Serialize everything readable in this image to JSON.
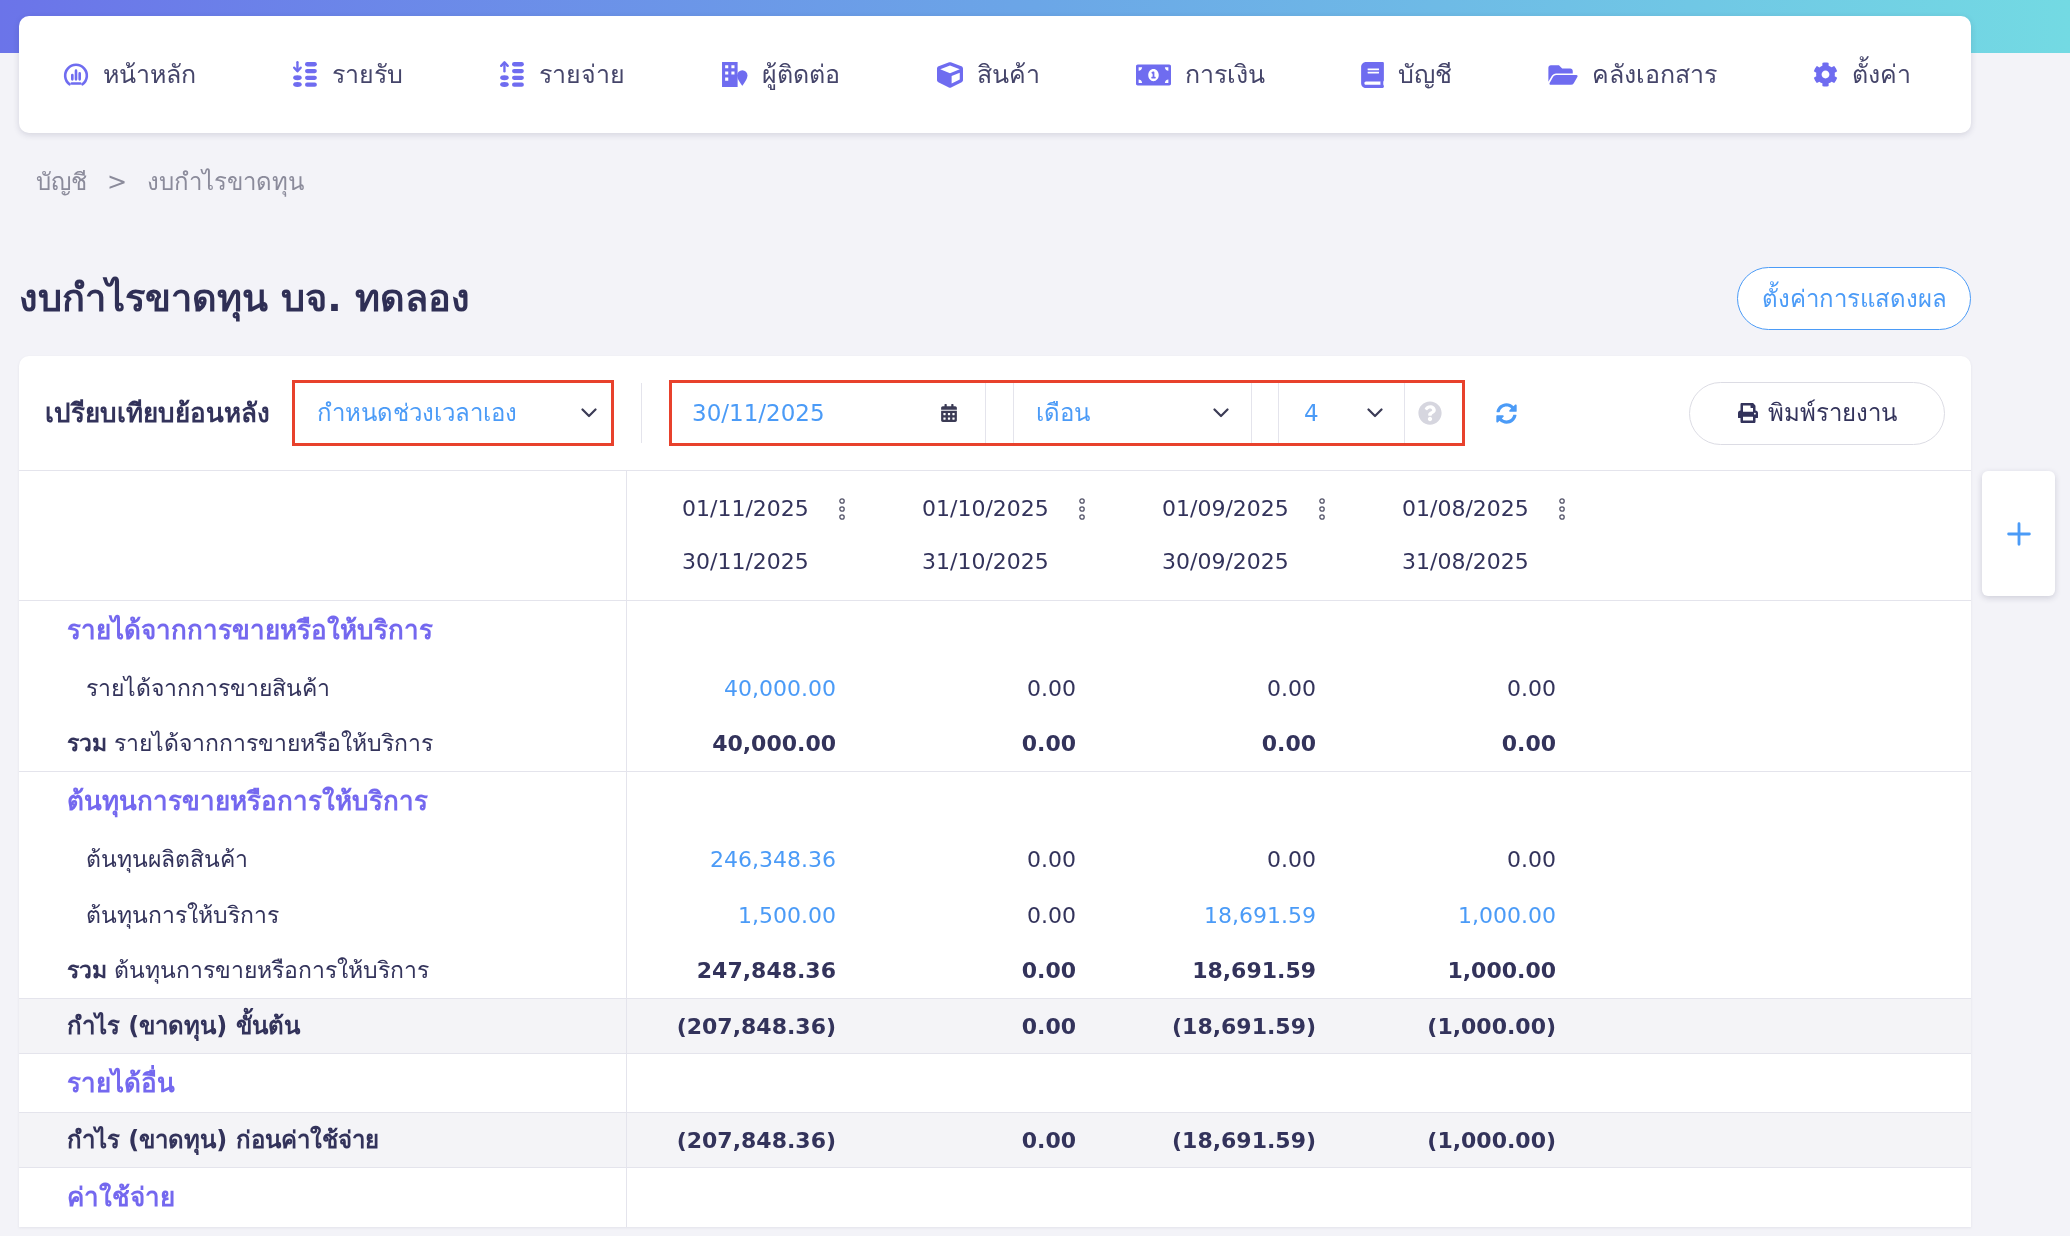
{
  "nav": {
    "items": [
      "หน้าหลัก",
      "รายรับ",
      "รายจ่าย",
      "ผู้ติดต่อ",
      "สินค้า",
      "การเงิน",
      "บัญชี",
      "คลังเอกสาร",
      "ตั้งค่า"
    ]
  },
  "breadcrumb": {
    "items": [
      "บัญชี",
      "งบกำไรขาดทุน"
    ],
    "separator": ">"
  },
  "title": "งบกำไรขาดทุน บจ. ทดลอง",
  "display_settings_button": {
    "label": "ตั้งค่าการแสดงผล"
  },
  "toolbar": {
    "label": "เปรียบเทียบย้อนหลัง",
    "range_select": {
      "value": "กำหนดช่วงเวลาเอง"
    },
    "date_field": {
      "value": "30/11/2025"
    },
    "period_select": {
      "value": "เดือน"
    },
    "count_select": {
      "value": "4"
    },
    "print_button": {
      "label": "พิมพ์รายงาน"
    }
  },
  "table": {
    "columns": [
      {
        "start": "01/11/2025",
        "end": "30/11/2025"
      },
      {
        "start": "01/10/2025",
        "end": "31/10/2025"
      },
      {
        "start": "01/09/2025",
        "end": "30/09/2025"
      },
      {
        "start": "01/08/2025",
        "end": "31/08/2025"
      }
    ],
    "rows": [
      {
        "kind": "section",
        "label": "รายได้จากการขายหรือให้บริการ"
      },
      {
        "kind": "item",
        "label": "รายได้จากการขายสินค้า",
        "values": [
          {
            "text": "40,000.00",
            "link": true
          },
          {
            "text": "0.00",
            "link": false
          },
          {
            "text": "0.00",
            "link": false
          },
          {
            "text": "0.00",
            "link": false
          }
        ]
      },
      {
        "kind": "total",
        "label": "**รวม** รายได้จากการขายหรือให้บริการ",
        "values": [
          "40,000.00",
          "0.00",
          "0.00",
          "0.00"
        ]
      },
      {
        "kind": "section",
        "label": "ต้นทุนการขายหรือการให้บริการ"
      },
      {
        "kind": "item",
        "label": "ต้นทุนผลิตสินค้า",
        "values": [
          {
            "text": "246,348.36",
            "link": true
          },
          {
            "text": "0.00",
            "link": false
          },
          {
            "text": "0.00",
            "link": false
          },
          {
            "text": "0.00",
            "link": false
          }
        ]
      },
      {
        "kind": "item",
        "label": "ต้นทุนการให้บริการ",
        "values": [
          {
            "text": "1,500.00",
            "link": true
          },
          {
            "text": "0.00",
            "link": false
          },
          {
            "text": "18,691.59",
            "link": true
          },
          {
            "text": "1,000.00",
            "link": true
          }
        ]
      },
      {
        "kind": "total",
        "label": "**รวม** ต้นทุนการขายหรือการให้บริการ",
        "values": [
          "247,848.36",
          "0.00",
          "18,691.59",
          "1,000.00"
        ]
      },
      {
        "kind": "subtotal",
        "label": "กำไร (ขาดทุน) ขั้นต้น",
        "values": [
          "(207,848.36)",
          "0.00",
          "(18,691.59)",
          "(1,000.00)"
        ]
      },
      {
        "kind": "section",
        "label": "รายได้อื่น"
      },
      {
        "kind": "subtotal",
        "label": "กำไร (ขาดทุน) ก่อนค่าใช้จ่าย",
        "values": [
          "(207,848.36)",
          "0.00",
          "(18,691.59)",
          "(1,000.00)"
        ]
      },
      {
        "kind": "section",
        "label": "ค่าใช้จ่าย"
      }
    ]
  }
}
